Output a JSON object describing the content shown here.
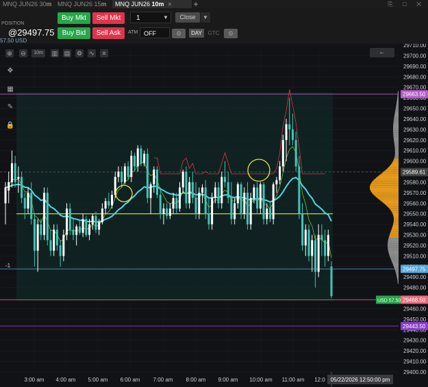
{
  "tabs": [
    {
      "label": "MNQ JUN26 30",
      "suffix": "m",
      "active": false
    },
    {
      "label": "MNQ JUN26 15",
      "suffix": "m",
      "active": false
    },
    {
      "label": "MNQ JUN26 ",
      "suffix": "10m",
      "active": true
    }
  ],
  "position": {
    "label": "POSITION",
    "price": "@29497.75",
    "pnl": "57.50 USD"
  },
  "buttons": {
    "buy_mkt": "Buy Mkt",
    "sell_mkt": "Sell Mkt",
    "buy_bid": "Buy Bid",
    "sell_ask": "Sell Ask",
    "close": "Close",
    "day": "DAY",
    "gtc": "GTC"
  },
  "order": {
    "qty": "1",
    "atm_label": "ATM",
    "atm_value": "OFF"
  },
  "toolbar": {
    "bars_label": "10m",
    "back_icon": "←"
  },
  "icons": {
    "zoom_in": "zoom-in-icon",
    "zoom_out": "zoom-out-icon",
    "crosshair": "crosshair-icon",
    "settings": "gear-icon"
  },
  "chart_data": {
    "type": "candlestick",
    "y_range": [
      29400,
      29710
    ],
    "price_ticks": [
      "29710.00",
      "29700.00",
      "29690.00",
      "29680.00",
      "29670.00",
      "29660.00",
      "29650.00",
      "29640.00",
      "29630.00",
      "29620.00",
      "29610.00",
      "29600.00",
      "29590.00",
      "29580.00",
      "29570.00",
      "29560.00",
      "29550.00",
      "29540.00",
      "29530.00",
      "29520.00",
      "29510.00",
      "29500.00",
      "29490.00",
      "29480.00",
      "29470.00",
      "29460.00",
      "29450.00",
      "29440.00",
      "29430.00",
      "29420.00",
      "29410.00",
      "29400.00"
    ],
    "time_ticks": [
      "3:00 am",
      "4:00 am",
      "5:00 am",
      "6:00 am",
      "7:00 am",
      "8:00 am",
      "9:00 am",
      "10:00 am",
      "11:00 am",
      "12:0"
    ],
    "crosshair_time": "05/22/2026 12:50:00 pm",
    "badges": [
      {
        "label": "29663.50",
        "price": 29663.5,
        "color": "#b45cc8"
      },
      {
        "label": "29589.61",
        "price": 29589.61,
        "color": "#444444"
      },
      {
        "label": "29497.75",
        "price": 29497.75,
        "color": "#56a8dc"
      },
      {
        "label": "29468.50",
        "price": 29468.5,
        "color": "#e86d7c"
      },
      {
        "label": "29443.50",
        "price": 29443.5,
        "color": "#8b3bd0"
      }
    ],
    "pnl_tag": "USD 57.50",
    "position_marker": "-1",
    "levels": {
      "yellow": 29550,
      "gray": 29589.61,
      "blue": 29497.75,
      "pink": 29468.5,
      "purple_top": 29663.5,
      "purple_bottom": 29443.5
    },
    "candles": [
      {
        "t": "2:50",
        "o": 29560,
        "h": 29580,
        "l": 29540,
        "c": 29575
      },
      {
        "t": "2:55",
        "o": 29572,
        "h": 29590,
        "l": 29560,
        "c": 29580
      },
      {
        "t": "3:00",
        "o": 29580,
        "h": 29610,
        "l": 29575,
        "c": 29598
      },
      {
        "t": "3:05",
        "o": 29598,
        "h": 29605,
        "l": 29575,
        "c": 29580
      },
      {
        "t": "3:10",
        "o": 29583,
        "h": 29595,
        "l": 29570,
        "c": 29585
      },
      {
        "t": "3:15",
        "o": 29585,
        "h": 29590,
        "l": 29560,
        "c": 29565
      },
      {
        "t": "3:20",
        "o": 29565,
        "h": 29570,
        "l": 29545,
        "c": 29555
      },
      {
        "t": "3:25",
        "o": 29555,
        "h": 29575,
        "l": 29550,
        "c": 29570
      },
      {
        "t": "3:30",
        "o": 29570,
        "h": 29580,
        "l": 29540,
        "c": 29545
      },
      {
        "t": "3:35",
        "o": 29545,
        "h": 29550,
        "l": 29500,
        "c": 29515
      },
      {
        "t": "3:40",
        "o": 29515,
        "h": 29545,
        "l": 29495,
        "c": 29540
      },
      {
        "t": "3:45",
        "o": 29540,
        "h": 29545,
        "l": 29525,
        "c": 29530
      },
      {
        "t": "3:50",
        "o": 29530,
        "h": 29575,
        "l": 29525,
        "c": 29570
      },
      {
        "t": "3:55",
        "o": 29570,
        "h": 29575,
        "l": 29520,
        "c": 29525
      },
      {
        "t": "4:00",
        "o": 29525,
        "h": 29535,
        "l": 29510,
        "c": 29515
      },
      {
        "t": "4:05",
        "o": 29515,
        "h": 29540,
        "l": 29510,
        "c": 29535
      },
      {
        "t": "4:10",
        "o": 29535,
        "h": 29540,
        "l": 29515,
        "c": 29520
      },
      {
        "t": "4:15",
        "o": 29520,
        "h": 29525,
        "l": 29500,
        "c": 29510
      },
      {
        "t": "4:20",
        "o": 29510,
        "h": 29535,
        "l": 29505,
        "c": 29530
      },
      {
        "t": "4:25",
        "o": 29530,
        "h": 29560,
        "l": 29525,
        "c": 29555
      },
      {
        "t": "4:30",
        "o": 29555,
        "h": 29560,
        "l": 29530,
        "c": 29535
      },
      {
        "t": "4:35",
        "o": 29535,
        "h": 29545,
        "l": 29525,
        "c": 29530
      },
      {
        "t": "4:40",
        "o": 29530,
        "h": 29540,
        "l": 29520,
        "c": 29538
      },
      {
        "t": "4:45",
        "o": 29538,
        "h": 29545,
        "l": 29530,
        "c": 29532
      },
      {
        "t": "4:50",
        "o": 29532,
        "h": 29550,
        "l": 29528,
        "c": 29545
      },
      {
        "t": "4:55",
        "o": 29545,
        "h": 29548,
        "l": 29528,
        "c": 29530
      },
      {
        "t": "5:00",
        "o": 29530,
        "h": 29545,
        "l": 29525,
        "c": 29540
      },
      {
        "t": "5:05",
        "o": 29540,
        "h": 29550,
        "l": 29535,
        "c": 29548
      },
      {
        "t": "5:10",
        "o": 29548,
        "h": 29552,
        "l": 29532,
        "c": 29535
      },
      {
        "t": "5:15",
        "o": 29535,
        "h": 29545,
        "l": 29530,
        "c": 29542
      },
      {
        "t": "5:20",
        "o": 29542,
        "h": 29560,
        "l": 29540,
        "c": 29555
      },
      {
        "t": "5:25",
        "o": 29555,
        "h": 29565,
        "l": 29550,
        "c": 29562
      },
      {
        "t": "5:30",
        "o": 29562,
        "h": 29570,
        "l": 29555,
        "c": 29558
      },
      {
        "t": "5:35",
        "o": 29558,
        "h": 29572,
        "l": 29555,
        "c": 29568
      },
      {
        "t": "5:40",
        "o": 29568,
        "h": 29590,
        "l": 29565,
        "c": 29585
      },
      {
        "t": "5:45",
        "o": 29585,
        "h": 29595,
        "l": 29580,
        "c": 29590
      },
      {
        "t": "5:50",
        "o": 29590,
        "h": 29595,
        "l": 29575,
        "c": 29580
      },
      {
        "t": "5:55",
        "o": 29580,
        "h": 29598,
        "l": 29578,
        "c": 29595
      },
      {
        "t": "6:00",
        "o": 29595,
        "h": 29600,
        "l": 29582,
        "c": 29585
      },
      {
        "t": "6:05",
        "o": 29585,
        "h": 29610,
        "l": 29580,
        "c": 29605
      },
      {
        "t": "6:10",
        "o": 29605,
        "h": 29608,
        "l": 29590,
        "c": 29595
      },
      {
        "t": "6:15",
        "o": 29595,
        "h": 29615,
        "l": 29590,
        "c": 29612
      },
      {
        "t": "6:20",
        "o": 29612,
        "h": 29615,
        "l": 29595,
        "c": 29598
      },
      {
        "t": "6:25",
        "o": 29598,
        "h": 29610,
        "l": 29595,
        "c": 29607
      },
      {
        "t": "6:30",
        "o": 29607,
        "h": 29612,
        "l": 29560,
        "c": 29565
      },
      {
        "t": "6:35",
        "o": 29565,
        "h": 29580,
        "l": 29550,
        "c": 29578
      },
      {
        "t": "6:40",
        "o": 29578,
        "h": 29595,
        "l": 29570,
        "c": 29592
      },
      {
        "t": "6:45",
        "o": 29592,
        "h": 29595,
        "l": 29565,
        "c": 29568
      },
      {
        "t": "6:50",
        "o": 29568,
        "h": 29575,
        "l": 29545,
        "c": 29550
      },
      {
        "t": "6:55",
        "o": 29550,
        "h": 29560,
        "l": 29540,
        "c": 29555
      },
      {
        "t": "7:00",
        "o": 29555,
        "h": 29560,
        "l": 29545,
        "c": 29548
      },
      {
        "t": "7:05",
        "o": 29548,
        "h": 29560,
        "l": 29545,
        "c": 29555
      },
      {
        "t": "7:10",
        "o": 29555,
        "h": 29570,
        "l": 29550,
        "c": 29565
      },
      {
        "t": "7:15",
        "o": 29565,
        "h": 29570,
        "l": 29550,
        "c": 29555
      },
      {
        "t": "7:20",
        "o": 29555,
        "h": 29580,
        "l": 29552,
        "c": 29575
      },
      {
        "t": "7:25",
        "o": 29575,
        "h": 29592,
        "l": 29570,
        "c": 29590
      },
      {
        "t": "7:30",
        "o": 29590,
        "h": 29595,
        "l": 29555,
        "c": 29560
      },
      {
        "t": "7:35",
        "o": 29560,
        "h": 29585,
        "l": 29555,
        "c": 29580
      },
      {
        "t": "7:40",
        "o": 29580,
        "h": 29590,
        "l": 29560,
        "c": 29565
      },
      {
        "t": "7:45",
        "o": 29565,
        "h": 29580,
        "l": 29545,
        "c": 29550
      },
      {
        "t": "7:50",
        "o": 29550,
        "h": 29575,
        "l": 29545,
        "c": 29570
      },
      {
        "t": "7:55",
        "o": 29570,
        "h": 29578,
        "l": 29560,
        "c": 29575
      },
      {
        "t": "8:00",
        "o": 29575,
        "h": 29582,
        "l": 29545,
        "c": 29550
      },
      {
        "t": "8:05",
        "o": 29550,
        "h": 29565,
        "l": 29535,
        "c": 29540
      },
      {
        "t": "8:10",
        "o": 29540,
        "h": 29570,
        "l": 29535,
        "c": 29565
      },
      {
        "t": "8:15",
        "o": 29565,
        "h": 29580,
        "l": 29560,
        "c": 29575
      },
      {
        "t": "8:20",
        "o": 29575,
        "h": 29580,
        "l": 29555,
        "c": 29560
      },
      {
        "t": "8:25",
        "o": 29560,
        "h": 29590,
        "l": 29555,
        "c": 29585
      },
      {
        "t": "8:30",
        "o": 29585,
        "h": 29600,
        "l": 29575,
        "c": 29580
      },
      {
        "t": "8:35",
        "o": 29580,
        "h": 29590,
        "l": 29560,
        "c": 29565
      },
      {
        "t": "8:40",
        "o": 29565,
        "h": 29580,
        "l": 29540,
        "c": 29545
      },
      {
        "t": "8:45",
        "o": 29545,
        "h": 29565,
        "l": 29540,
        "c": 29560
      },
      {
        "t": "8:50",
        "o": 29560,
        "h": 29580,
        "l": 29555,
        "c": 29578
      },
      {
        "t": "8:55",
        "o": 29578,
        "h": 29580,
        "l": 29545,
        "c": 29550
      },
      {
        "t": "9:00",
        "o": 29550,
        "h": 29575,
        "l": 29545,
        "c": 29570
      },
      {
        "t": "9:05",
        "o": 29570,
        "h": 29580,
        "l": 29535,
        "c": 29540
      },
      {
        "t": "9:10",
        "o": 29540,
        "h": 29570,
        "l": 29535,
        "c": 29565
      },
      {
        "t": "9:15",
        "o": 29565,
        "h": 29578,
        "l": 29560,
        "c": 29575
      },
      {
        "t": "9:20",
        "o": 29575,
        "h": 29580,
        "l": 29550,
        "c": 29555
      },
      {
        "t": "9:25",
        "o": 29555,
        "h": 29580,
        "l": 29550,
        "c": 29578
      },
      {
        "t": "9:30",
        "o": 29578,
        "h": 29580,
        "l": 29540,
        "c": 29545
      },
      {
        "t": "9:35",
        "o": 29545,
        "h": 29560,
        "l": 29540,
        "c": 29555
      },
      {
        "t": "9:40",
        "o": 29555,
        "h": 29562,
        "l": 29542,
        "c": 29545
      },
      {
        "t": "9:45",
        "o": 29545,
        "h": 29580,
        "l": 29540,
        "c": 29578
      },
      {
        "t": "9:50",
        "o": 29578,
        "h": 29585,
        "l": 29570,
        "c": 29582
      },
      {
        "t": "9:55",
        "o": 29582,
        "h": 29600,
        "l": 29578,
        "c": 29595
      },
      {
        "t": "10:00",
        "o": 29595,
        "h": 29625,
        "l": 29590,
        "c": 29620
      },
      {
        "t": "10:05",
        "o": 29620,
        "h": 29640,
        "l": 29600,
        "c": 29635
      },
      {
        "t": "10:10",
        "o": 29635,
        "h": 29660,
        "l": 29615,
        "c": 29630
      },
      {
        "t": "10:15",
        "o": 29630,
        "h": 29645,
        "l": 29615,
        "c": 29620
      },
      {
        "t": "10:20",
        "o": 29620,
        "h": 29628,
        "l": 29590,
        "c": 29595
      },
      {
        "t": "10:25",
        "o": 29595,
        "h": 29605,
        "l": 29545,
        "c": 29550
      },
      {
        "t": "10:30",
        "o": 29550,
        "h": 29560,
        "l": 29515,
        "c": 29520
      },
      {
        "t": "10:35",
        "o": 29520,
        "h": 29540,
        "l": 29510,
        "c": 29535
      },
      {
        "t": "10:40",
        "o": 29535,
        "h": 29540,
        "l": 29505,
        "c": 29510
      },
      {
        "t": "10:45",
        "o": 29510,
        "h": 29530,
        "l": 29495,
        "c": 29525
      },
      {
        "t": "10:50",
        "o": 29525,
        "h": 29530,
        "l": 29480,
        "c": 29495
      },
      {
        "t": "10:55",
        "o": 29495,
        "h": 29540,
        "l": 29490,
        "c": 29530
      },
      {
        "t": "11:00",
        "o": 29530,
        "h": 29540,
        "l": 29510,
        "c": 29525
      },
      {
        "t": "11:05",
        "o": 29525,
        "h": 29535,
        "l": 29500,
        "c": 29510
      },
      {
        "t": "11:10",
        "o": 29510,
        "h": 29535,
        "l": 29505,
        "c": 29530
      },
      {
        "t": "11:15",
        "o": 29500,
        "h": 29505,
        "l": 29470,
        "c": 29472
      }
    ]
  }
}
